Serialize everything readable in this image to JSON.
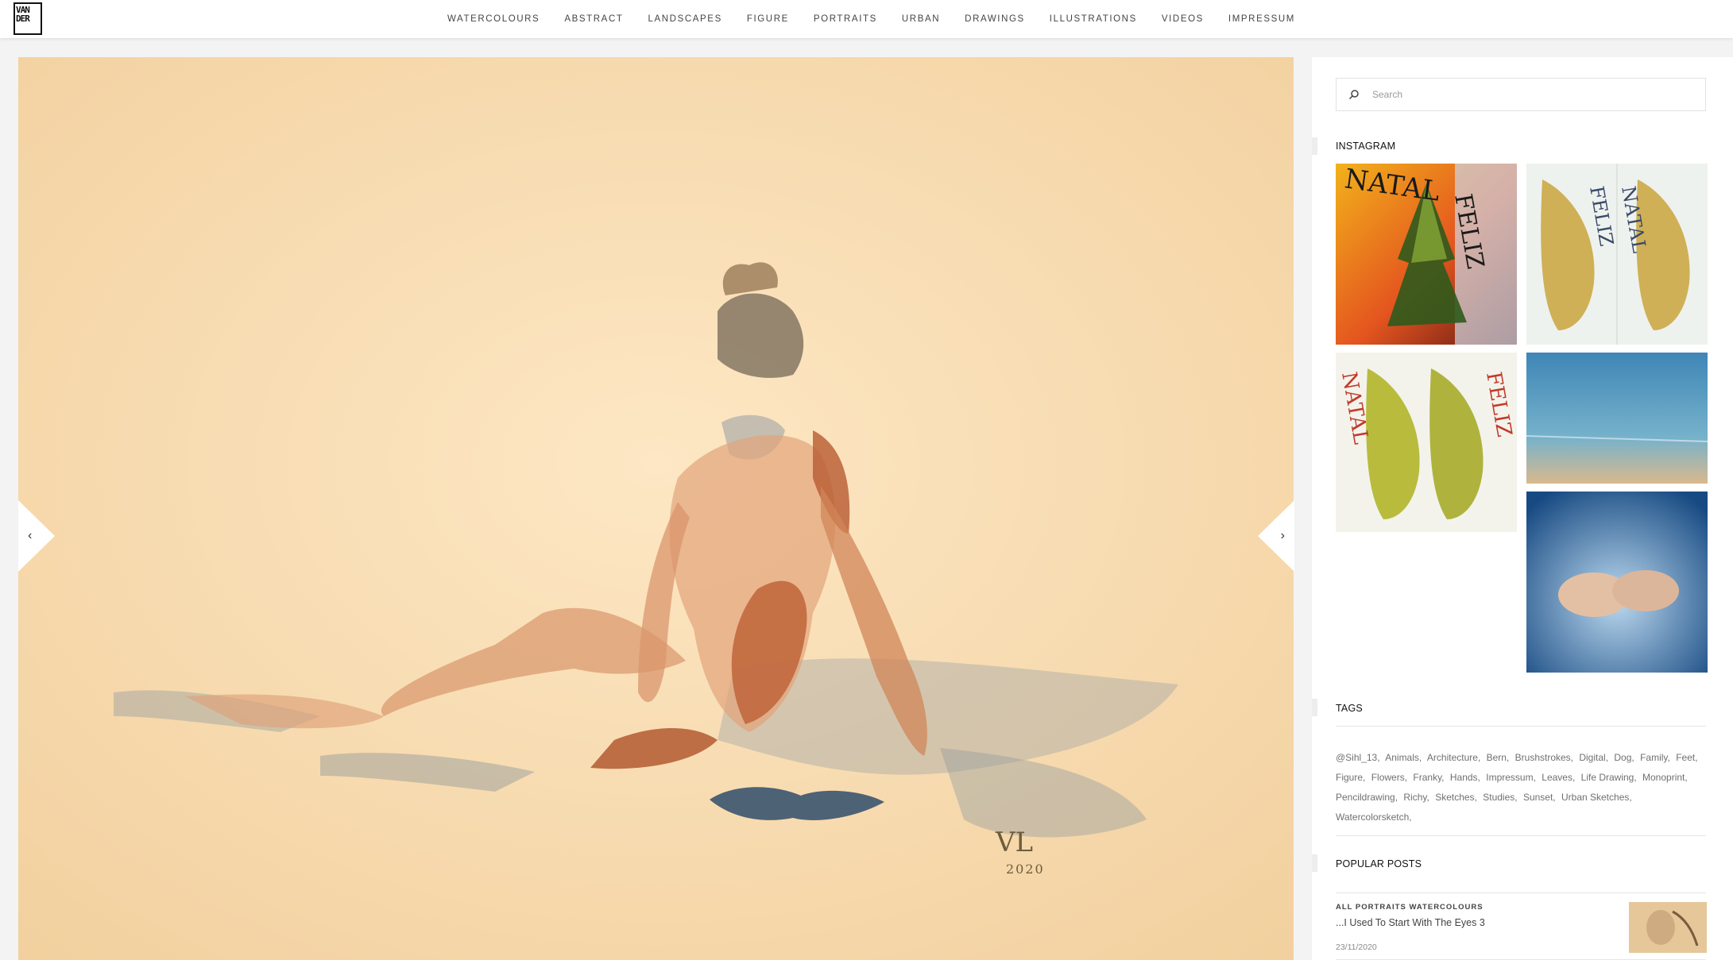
{
  "logo": {
    "lines": [
      "VAN",
      "DER"
    ],
    "icon": "vander-logo-icon"
  },
  "nav": {
    "items": [
      "WATERCOLOURS",
      "ABSTRACT",
      "LANDSCAPES",
      "FIGURE",
      "PORTRAITS",
      "URBAN",
      "DRAWINGS",
      "ILLUSTRATIONS",
      "VIDEOS",
      "IMPRESSUM"
    ]
  },
  "slider": {
    "prev_icon": "chevron-left-icon",
    "next_icon": "chevron-right-icon",
    "prev_glyph": "‹",
    "next_glyph": "›",
    "signature_initials": "VL",
    "signature_year": "2020"
  },
  "sidebar": {
    "search": {
      "placeholder": "Search",
      "icon": "search-icon"
    },
    "instagram": {
      "title": "INSTAGRAM",
      "tiles": [
        {
          "left_text": "NATAL",
          "right_text": "FELIZ",
          "kind": "tree-orange"
        },
        {
          "left_text": "FELIZ",
          "right_text": "NATAL",
          "kind": "leaves-double"
        },
        {
          "left_text": "NATAL",
          "right_text": "FELIZ",
          "kind": "leaves-green"
        },
        {
          "kind": "sea"
        },
        {
          "kind": "feet-blue"
        }
      ]
    },
    "tags": {
      "title": "TAGS",
      "items": [
        "@Sihl_13,",
        "Animals,",
        "Architecture,",
        "Bern,",
        "Brushstrokes,",
        "Digital,",
        "Dog,",
        "Family,",
        "Feet,",
        "Figure,",
        "Flowers,",
        "Franky,",
        "Hands,",
        "Impressum,",
        "Leaves,",
        "Life Drawing,",
        "Monoprint,",
        "Pencildrawing,",
        "Richy,",
        "Sketches,",
        "Studies,",
        "Sunset,",
        "Urban Sketches,",
        "Watercolorsketch,"
      ]
    },
    "popular": {
      "title": "POPULAR POSTS",
      "post": {
        "category": "ALL PORTRAITS WATERCOLOURS",
        "title": "...I Used To Start With The Eyes 3",
        "date": "23/11/2020"
      }
    }
  },
  "colors": {
    "paper": "#f7dcae",
    "skin": "#c8734a",
    "text": "#444444",
    "muted": "#707070"
  }
}
